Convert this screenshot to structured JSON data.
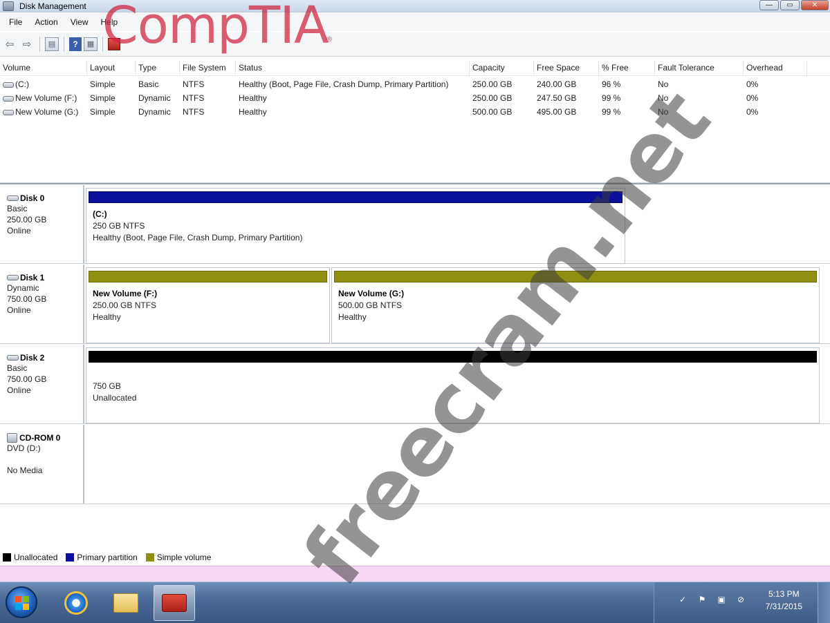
{
  "window": {
    "title": "Disk Management",
    "controls": {
      "minimize": "—",
      "maximize": "▭",
      "close": "✕"
    }
  },
  "menu": [
    "File",
    "Action",
    "View",
    "Help"
  ],
  "toolbar": {
    "icons": [
      "back-arrow-icon",
      "forward-arrow-icon",
      "show-hide-tree-icon",
      "help-icon",
      "properties-icon",
      "disk-management-icon"
    ]
  },
  "volume_list": {
    "columns": [
      "Volume",
      "Layout",
      "Type",
      "File System",
      "Status",
      "Capacity",
      "Free Space",
      "% Free",
      "Fault Tolerance",
      "Overhead"
    ],
    "rows": [
      [
        "(C:)",
        "Simple",
        "Basic",
        "NTFS",
        "Healthy (Boot, Page File, Crash Dump, Primary Partition)",
        "250.00 GB",
        "240.00 GB",
        "96 %",
        "No",
        "0%"
      ],
      [
        "New Volume (F:)",
        "Simple",
        "Dynamic",
        "NTFS",
        "Healthy",
        "250.00 GB",
        "247.50 GB",
        "99 %",
        "No",
        "0%"
      ],
      [
        "New Volume (G:)",
        "Simple",
        "Dynamic",
        "NTFS",
        "Healthy",
        "500.00 GB",
        "495.00 GB",
        "99 %",
        "No",
        "0%"
      ]
    ]
  },
  "disks": {
    "disk0": {
      "name": "Disk 0",
      "type": "Basic",
      "size": "250.00 GB",
      "status": "Online",
      "partition": {
        "name": "(C:)",
        "line1": "250 GB NTFS",
        "line2": "Healthy (Boot, Page File, Crash Dump, Primary Partition)"
      }
    },
    "disk1": {
      "name": "Disk 1",
      "type": "Dynamic",
      "size": "750.00 GB",
      "status": "Online",
      "partitions": [
        {
          "name": "New Volume (F:)",
          "line1": "250.00 GB NTFS",
          "line2": "Healthy"
        },
        {
          "name": "New Volume (G:)",
          "line1": "500.00 GB NTFS",
          "line2": "Healthy"
        }
      ]
    },
    "disk2": {
      "name": "Disk 2",
      "type": "Basic",
      "size": "750.00 GB",
      "status": "Online",
      "partition": {
        "line1": "750 GB",
        "line2": "Unallocated"
      }
    },
    "cdrom0": {
      "name": "CD-ROM 0",
      "drive": "DVD (D:)",
      "media": "No Media"
    }
  },
  "legend": [
    {
      "label": "Unallocated",
      "color": "#000000"
    },
    {
      "label": "Primary partition",
      "color": "#0a0f9c"
    },
    {
      "label": "Simple volume",
      "color": "#8f8f12"
    }
  ],
  "taskbar": {
    "pinned": [
      "internet-explorer-icon",
      "windows-explorer-icon",
      "computer-management-icon"
    ],
    "clock": {
      "time": "5:13 PM",
      "date": "7/31/2015"
    }
  },
  "watermarks": {
    "logo": "CompTIA",
    "logo_mark": "®",
    "diagonal": "freecram.net"
  }
}
